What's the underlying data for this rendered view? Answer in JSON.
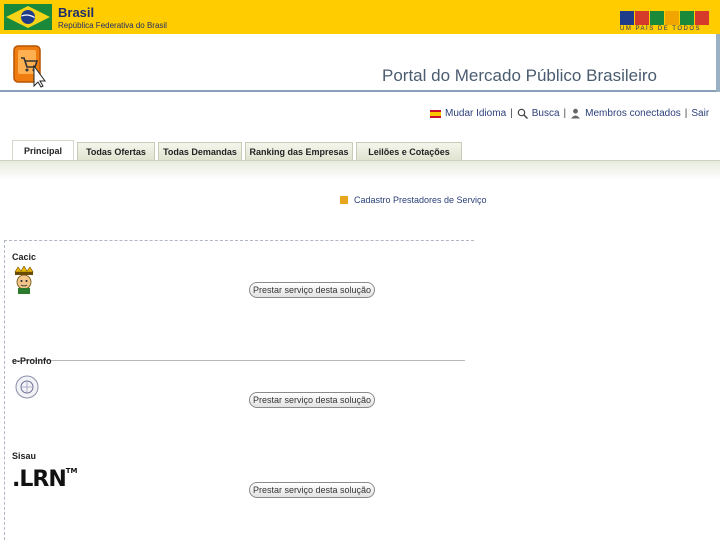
{
  "gov_bar": {
    "name": "Brasil",
    "subtitle": "República Federativa do Brasil",
    "brand_logo_letters": "BRASIL",
    "brand_slogan": "UM PAÍS DE TODOS"
  },
  "header": {
    "title": "Portal do Mercado Público Brasileiro"
  },
  "utility_links": {
    "language": "Mudar Idioma",
    "search": "Busca",
    "members": "Membros conectados",
    "logout": "Sair",
    "separator": "|"
  },
  "tabs": [
    {
      "label": "Principal"
    },
    {
      "label": "Todas Ofertas"
    },
    {
      "label": "Todas Demandas"
    },
    {
      "label": "Ranking das Empresas"
    },
    {
      "label": "Leilões e Cotações"
    }
  ],
  "cadastro": {
    "label": "Cadastro Prestadores de Serviço"
  },
  "solutions": [
    {
      "name": "Cacic",
      "button_label": "Prestar serviço desta solução"
    },
    {
      "name": "e-ProInfo",
      "button_label": "Prestar serviço desta solução"
    },
    {
      "name": "Sisau",
      "button_label": "Prestar serviço desta solução",
      "logo_text": ".LRN",
      "logo_tm": "TM"
    }
  ],
  "colors": {
    "gov_yellow": "#ffcc00",
    "link_blue": "#2b3f7a",
    "title_gray": "#4a5c70",
    "accent_orange": "#e8a520"
  }
}
